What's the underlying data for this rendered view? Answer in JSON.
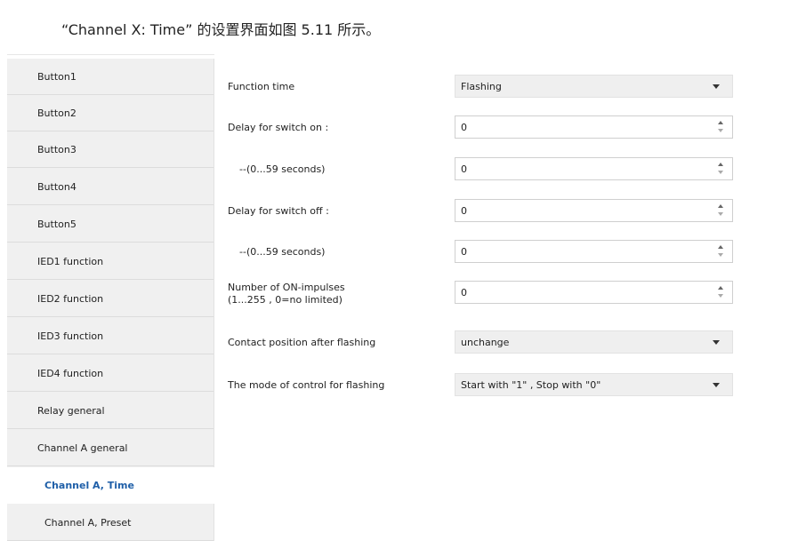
{
  "caption": "“Channel X: Time” 的设置界面如图 5.11 所示。",
  "sidebar": {
    "items": [
      {
        "label": "Button1"
      },
      {
        "label": "Button2"
      },
      {
        "label": "Button3"
      },
      {
        "label": "Button4"
      },
      {
        "label": "Button5"
      },
      {
        "label": "IED1 function"
      },
      {
        "label": "IED2 function"
      },
      {
        "label": "IED3 function"
      },
      {
        "label": "IED4 function"
      },
      {
        "label": "Relay general"
      },
      {
        "label": "Channel A general"
      },
      {
        "label": "Channel A, Time"
      },
      {
        "label": "Channel A, Preset"
      }
    ],
    "active_index": 11
  },
  "params": {
    "function_time": {
      "label": "Function time",
      "value": "Flashing"
    },
    "delay_on": {
      "label": "Delay for switch on :",
      "value": "0"
    },
    "delay_on_seconds": {
      "label": "--(0...59 seconds)",
      "value": "0"
    },
    "delay_off": {
      "label": "Delay for switch off :",
      "value": "0"
    },
    "delay_off_seconds": {
      "label": "--(0...59 seconds)",
      "value": "0"
    },
    "on_impulses": {
      "label_line1": "Number of ON-impulses",
      "label_line2": "(1...255 , 0=no limited)",
      "value": "0"
    },
    "contact_position": {
      "label": "Contact position after flashing",
      "value": "unchange"
    },
    "control_mode": {
      "label": "The mode of control for flashing",
      "value": "Start with \"1\" , Stop with \"0\""
    }
  }
}
